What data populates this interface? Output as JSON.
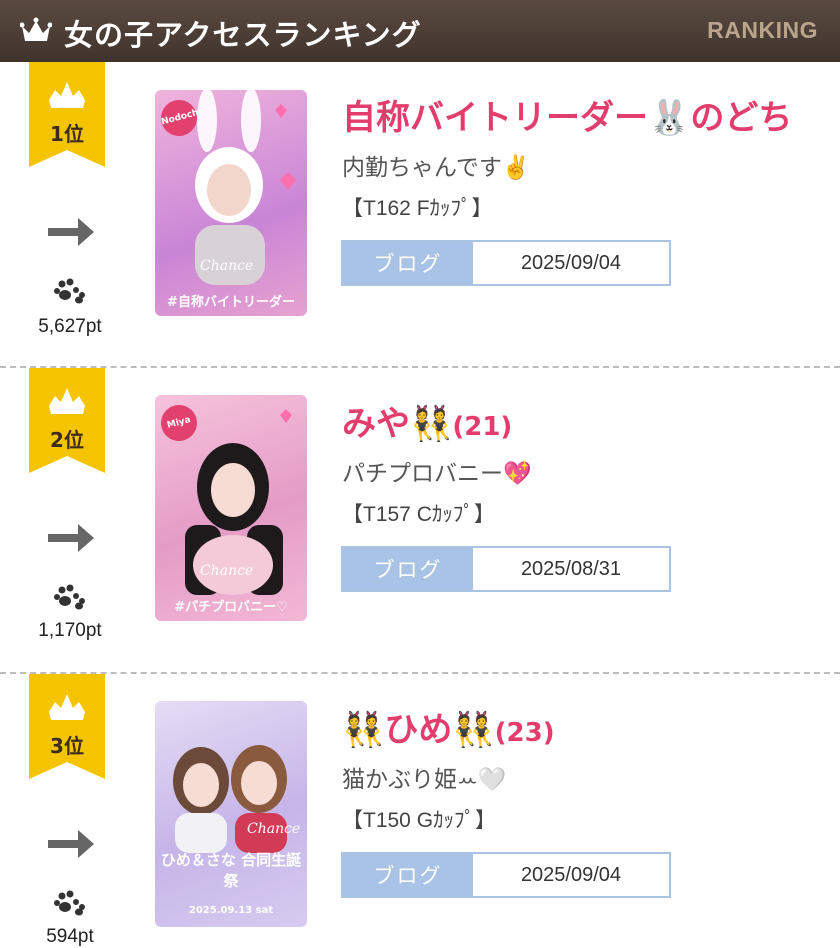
{
  "header": {
    "title": "女の子アクセスランキング",
    "ranking_label": "RANKING"
  },
  "colors": {
    "header_bg": "#4a3d34",
    "rank_flag": "#f5c400",
    "name": "#e23d6c",
    "blog_button": "#a9c3e6"
  },
  "entries": [
    {
      "rank": "1位",
      "trend_icon": "arrow-right-icon",
      "points": "5,627pt",
      "name": "自称バイトリーダー🐰のどち",
      "age": "",
      "catchphrase": "内勤ちゃんです✌️",
      "spec": "【T162 Fｶｯﾌﾟ】",
      "blog_label": "ブログ",
      "blog_date": "2025/09/04",
      "photo_caption": "#自称バイトリーダー",
      "photo_tag": "Nodochi",
      "photo_brand": "Chance",
      "photo_colors": [
        "#e9a4d6",
        "#c785d8"
      ]
    },
    {
      "rank": "2位",
      "trend_icon": "arrow-right-icon",
      "points": "1,170pt",
      "name": "みや👯",
      "age": "(21)",
      "catchphrase": "パチプロバニー💖",
      "spec": "【T157 Cｶｯﾌﾟ】",
      "blog_label": "ブログ",
      "blog_date": "2025/08/31",
      "photo_caption": "#パチプロバニー♡",
      "photo_tag": "Miya",
      "photo_brand": "Chance",
      "photo_colors": [
        "#f3b3d4",
        "#d98ac0"
      ]
    },
    {
      "rank": "3位",
      "trend_icon": "arrow-right-icon",
      "points": "594pt",
      "name": "👯ひめ👯",
      "age": "(23)",
      "catchphrase": "猫かぶり姫ꕀ🤍",
      "spec": "【T150 Gｶｯﾌﾟ】",
      "blog_label": "ブログ",
      "blog_date": "2025/09/04",
      "photo_caption": "ひめ＆さな 合同生誕祭",
      "photo_subcaption": "2025.09.13 sat",
      "photo_tag": "",
      "photo_brand": "Chance",
      "photo_colors": [
        "#d9cdf0",
        "#b7a7e0"
      ]
    }
  ]
}
